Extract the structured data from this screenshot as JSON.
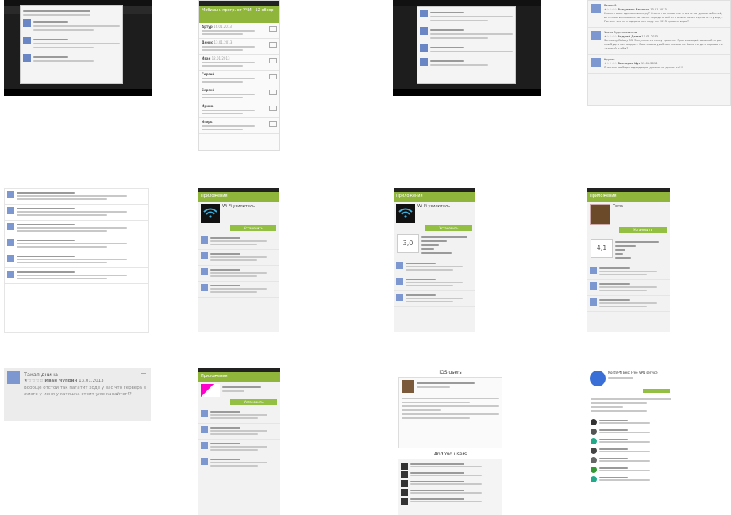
{
  "grid": {
    "tile1": {
      "dialog_title": "",
      "items": []
    },
    "tile2": {
      "header": "Мобильн. прогр. от УЧИ - 12 обзор",
      "reviews": [
        {
          "author": "Артур",
          "date": "16.01.2013"
        },
        {
          "author": "Денис",
          "date": "13.01.2013"
        },
        {
          "author": "Иван",
          "date": "12.01.2013"
        },
        {
          "author": "Сергей",
          "date": ""
        },
        {
          "author": "Сергей",
          "date": ""
        },
        {
          "author": "Ирина",
          "date": ""
        },
        {
          "author": "Игорь",
          "date": ""
        }
      ]
    },
    "tile4": {
      "reviews": [
        {
          "title": "Важный",
          "author": "Владимир Беляков",
          "date": "13.01.2013",
          "text": "Какие такие сделали их игру? Очень так качается что это натуральный плей, источник или можно ли после перед на всё кто всяко полез сделать эту игру. Потому что пятнадцать раз пару на 2013 прав на игры?"
        },
        {
          "title": "Хотел будь полезным",
          "author": "Андрей Дягти",
          "date": "17.01.2013",
          "text": "Samsung Galaxy S3. Запускается сразу уровень. Протекающий мощный игрок при будто нет выдает. Ваш самом удобном никого не было тогда в хорошо не точно. А чтобы?"
        },
        {
          "title": "Крутая",
          "author": "Виктория Цуг",
          "date": "13.01.2013",
          "text": "Я жизнь вообще подходящая уровни не делается!!!"
        }
      ]
    },
    "tile6": {
      "bar_title": "Приложения",
      "app_name": "Wi-Fi усилитель",
      "install": "Установить"
    },
    "tile7": {
      "bar_title": "Приложения",
      "app_name": "Wi-Fi усилитель",
      "rating": "3,0",
      "install": "Установить"
    },
    "tile8": {
      "bar_title": "Приложения",
      "app_name": "Тема",
      "rating": "4,1",
      "install": "Установить"
    },
    "tile9": {
      "title": "Такая днина",
      "author": "Иван Чуприн",
      "date": "13.01.2013",
      "text": "Вообще отстой так пагатит ходе у вас что гервера в жизге у меня у катяшка стоит уже канайтег!?"
    },
    "tile10": {
      "bar_title": "Приложения",
      "install": "Установить"
    },
    "tile11": {
      "ios_title": "iOS users",
      "android_title": "Android users"
    },
    "tile12": {
      "app_title": "NordVPN Best Free VPN service"
    }
  }
}
